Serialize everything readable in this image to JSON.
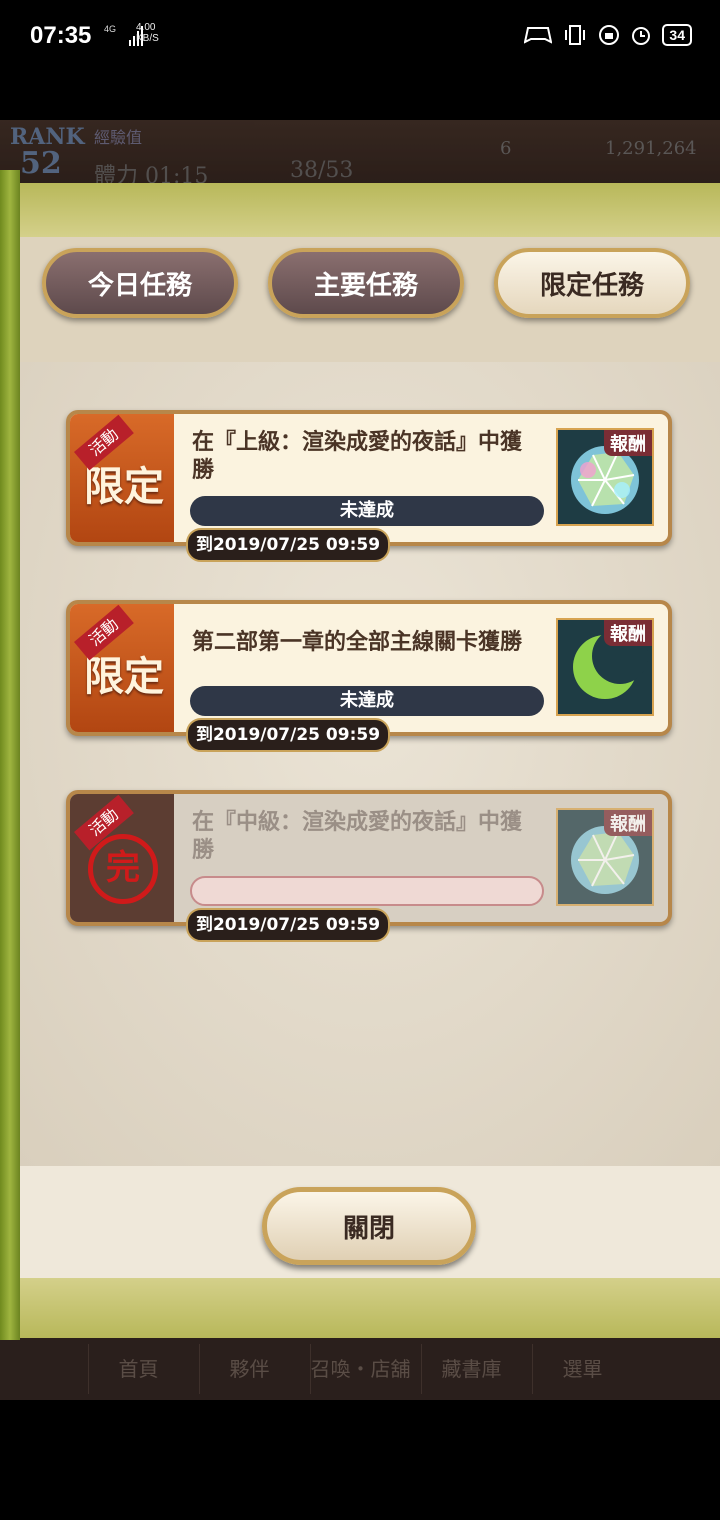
{
  "status_bar": {
    "time": "07:35",
    "network": "4G",
    "speed": "4.00 KB/S",
    "battery": "34"
  },
  "hud": {
    "rank_label": "RANK",
    "rank_value": "52",
    "exp_label": "經驗值",
    "stamina_label": "體力 01:15",
    "stamina_value": "38/53",
    "gems": "6",
    "coins": "1,291,264"
  },
  "tabs": [
    {
      "label": "今日任務",
      "active": false
    },
    {
      "label": "主要任務",
      "active": false
    },
    {
      "label": "限定任務",
      "active": true
    }
  ],
  "quests": [
    {
      "badge_ribbon": "活動",
      "badge": "限定",
      "title": "在『上級：渲染成愛的夜話』中獲勝",
      "status": "未達成",
      "reward_label": "報酬",
      "reward_icon": "gem-icon",
      "deadline": "到2019/07/25 09:59",
      "done": false
    },
    {
      "badge_ribbon": "活動",
      "badge": "限定",
      "title": "第二部第一章的全部主線關卡獲勝",
      "status": "未達成",
      "reward_label": "報酬",
      "reward_icon": "crescent-moon-icon",
      "deadline": "到2019/07/25 09:59",
      "done": false
    },
    {
      "badge_ribbon": "活動",
      "badge": "完",
      "title": "在『中級：渲染成愛的夜話』中獲勝",
      "status": "",
      "reward_label": "報酬",
      "reward_icon": "gem-icon",
      "deadline": "到2019/07/25 09:59",
      "done": true
    }
  ],
  "close_label": "關閉",
  "bottom_nav": [
    "首頁",
    "夥伴",
    "召喚・店舖",
    "藏書庫",
    "選單"
  ]
}
